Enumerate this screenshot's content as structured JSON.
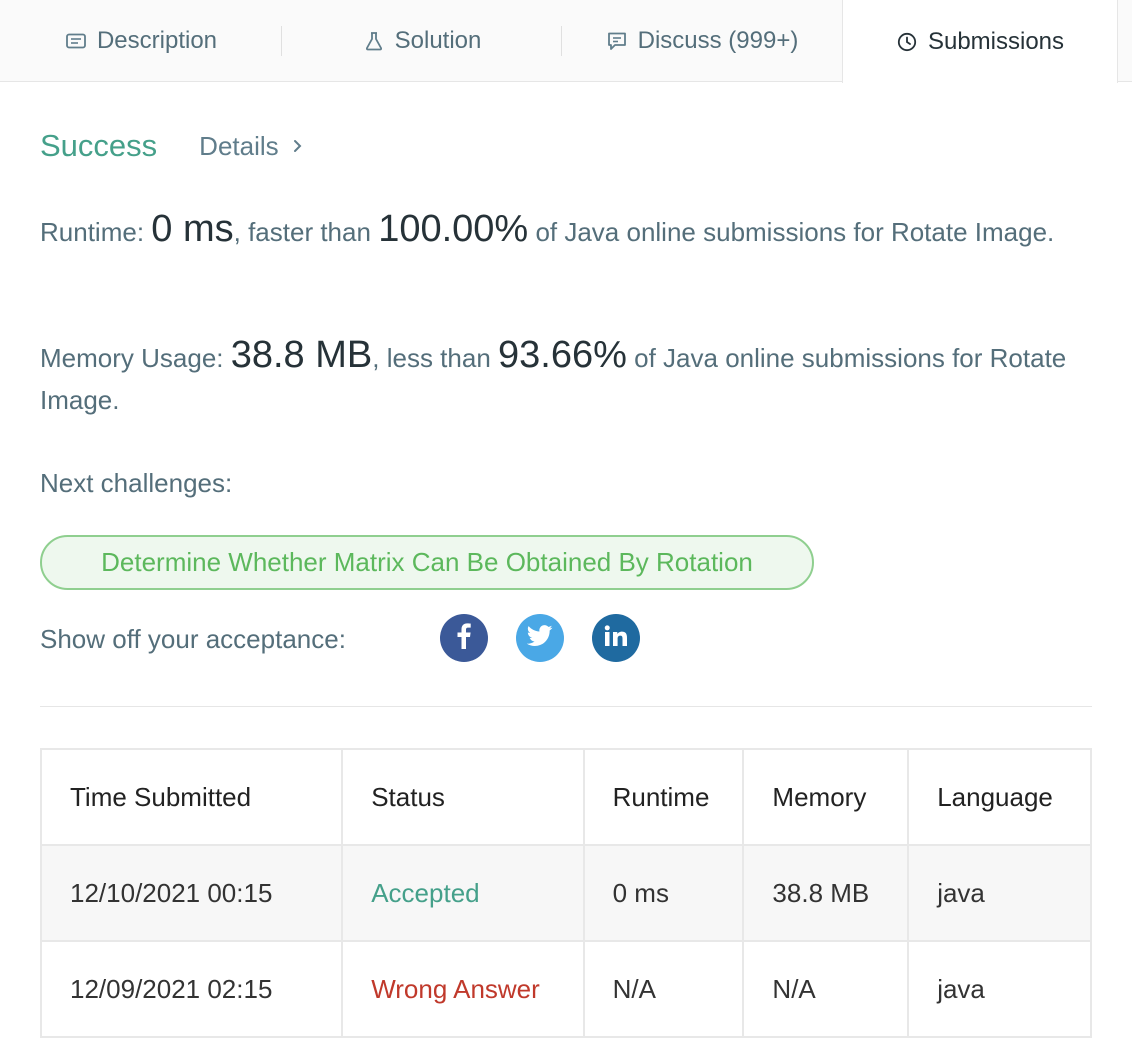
{
  "tabs": [
    {
      "label": "Description",
      "icon": "description-icon"
    },
    {
      "label": "Solution",
      "icon": "flask-icon"
    },
    {
      "label": "Discuss (999+)",
      "icon": "chat-icon"
    },
    {
      "label": "Submissions",
      "icon": "clock-icon",
      "active": true
    }
  ],
  "result": {
    "status": "Success",
    "details_label": "Details",
    "runtime": {
      "label": "Runtime:",
      "value": "0 ms",
      "mid": ", faster than",
      "percent": "100.00%",
      "tail": "of Java online submissions for Rotate Image."
    },
    "memory": {
      "label": "Memory Usage:",
      "value": "38.8 MB",
      "mid": ", less than",
      "percent": "93.66%",
      "tail": "of Java online submissions for Rotate Image."
    }
  },
  "next": {
    "label": "Next challenges:",
    "challenge": "Determine Whether Matrix Can Be Obtained By Rotation"
  },
  "share": {
    "label": "Show off your acceptance:",
    "colors": {
      "facebook": "#3b5998",
      "twitter": "#4aa8e6",
      "linkedin": "#1f6aa0"
    }
  },
  "table": {
    "headers": [
      "Time Submitted",
      "Status",
      "Runtime",
      "Memory",
      "Language"
    ],
    "rows": [
      {
        "time": "12/10/2021 00:15",
        "status": "Accepted",
        "runtime": "0 ms",
        "memory": "38.8 MB",
        "language": "java"
      },
      {
        "time": "12/09/2021 02:15",
        "status": "Wrong Answer",
        "runtime": "N/A",
        "memory": "N/A",
        "language": "java"
      }
    ]
  },
  "colors": {
    "success": "#45a08a",
    "wrong": "#c0392b",
    "challenge": "#5cb85c"
  }
}
